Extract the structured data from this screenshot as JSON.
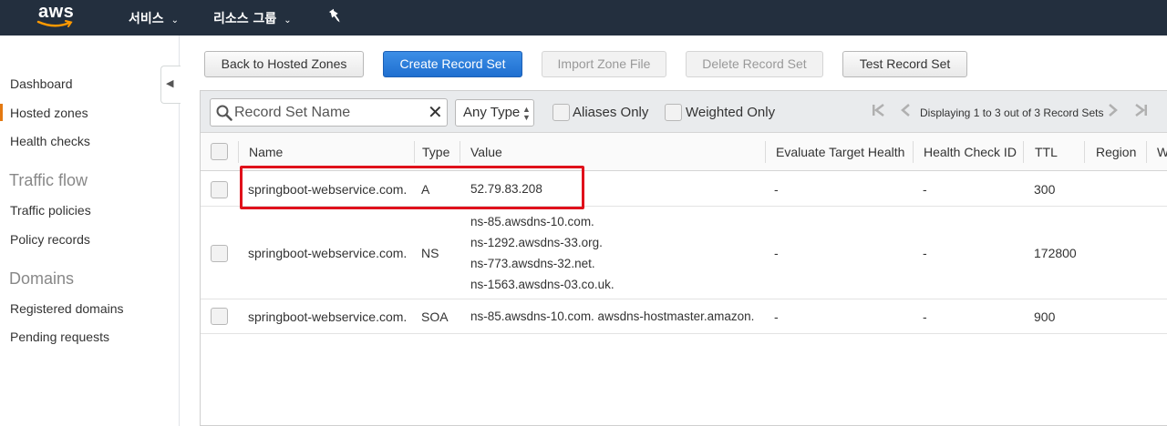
{
  "topnav": {
    "logo": "aws",
    "services_label": "서비스",
    "resource_groups_label": "리소스 그룹",
    "chevron": "⌄",
    "pin_icon": "pin-icon"
  },
  "sidebar": {
    "items": [
      {
        "label": "Dashboard"
      },
      {
        "label": "Hosted zones",
        "active": true
      },
      {
        "label": "Health checks"
      }
    ],
    "traffic_flow": {
      "heading": "Traffic flow",
      "items": [
        {
          "label": "Traffic policies"
        },
        {
          "label": "Policy records"
        }
      ]
    },
    "domains": {
      "heading": "Domains",
      "items": [
        {
          "label": "Registered domains"
        },
        {
          "label": "Pending requests"
        }
      ]
    },
    "collapse_icon": "◀"
  },
  "actions": {
    "back": "Back to Hosted Zones",
    "create": "Create Record Set",
    "import": "Import Zone File",
    "delete": "Delete Record Set",
    "test": "Test Record Set"
  },
  "filter": {
    "search_placeholder": "Record Set Name",
    "search_value": "",
    "clear": "✕",
    "type_value": "Any Type",
    "aliases_only": "Aliases Only",
    "weighted_only": "Weighted Only",
    "pagination_text": "Displaying 1 to 3 out of 3 Record Sets",
    "pager_first": "|◀",
    "pager_prev": "◀",
    "pager_next": "▶",
    "pager_last": "▶|"
  },
  "table": {
    "columns": {
      "name": "Name",
      "type": "Type",
      "value": "Value",
      "evaluate": "Evaluate Target Health",
      "health_check": "Health Check ID",
      "ttl": "TTL",
      "region": "Region",
      "more": "W"
    },
    "rows": [
      {
        "name": "springboot-webservice.com.",
        "type": "A",
        "values": [
          "52.79.83.208"
        ],
        "evaluate": "-",
        "health_check": "-",
        "ttl": "300"
      },
      {
        "name": "springboot-webservice.com.",
        "type": "NS",
        "values": [
          "ns-85.awsdns-10.com.",
          "ns-1292.awsdns-33.org.",
          "ns-773.awsdns-32.net.",
          "ns-1563.awsdns-03.co.uk."
        ],
        "evaluate": "-",
        "health_check": "-",
        "ttl": "172800"
      },
      {
        "name": "springboot-webservice.com.",
        "type": "SOA",
        "values": [
          "ns-85.awsdns-10.com. awsdns-hostmaster.amazon."
        ],
        "evaluate": "-",
        "health_check": "-",
        "ttl": "900"
      }
    ]
  },
  "colors": {
    "navbar": "#232f3e",
    "primary_button": "#1f6fd0",
    "highlight_box": "#e0111b",
    "active_accent": "#e47911"
  }
}
